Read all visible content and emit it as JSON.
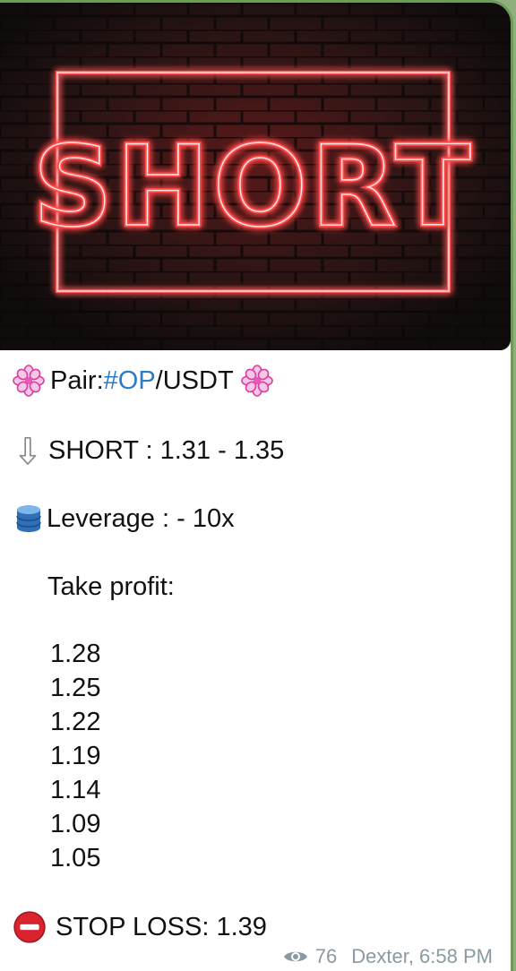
{
  "post": {
    "image": {
      "sign_text": "SHORT",
      "description": "neon-sign-on-brick-wall"
    },
    "pair_label": "Pair: ",
    "pair_hashtag": "#OP",
    "pair_rest": "/USDT",
    "short_line": "SHORT : 1.31 - 1.35",
    "leverage_line": "Leverage : - 10x",
    "take_profit_label": "Take profit:",
    "take_profits": [
      "1.28",
      "1.25",
      "1.22",
      "1.19",
      "1.14",
      "1.09",
      "1.05"
    ],
    "stop_loss_line": "STOP LOSS: 1.39",
    "views": "76",
    "author_time": "Dexter, 6:58 PM",
    "icons": {
      "flower": "pink-flower-icon",
      "arrow": "down-arrow-icon",
      "db": "database-icon",
      "stop": "no-entry-icon",
      "views": "eye-icon"
    }
  }
}
